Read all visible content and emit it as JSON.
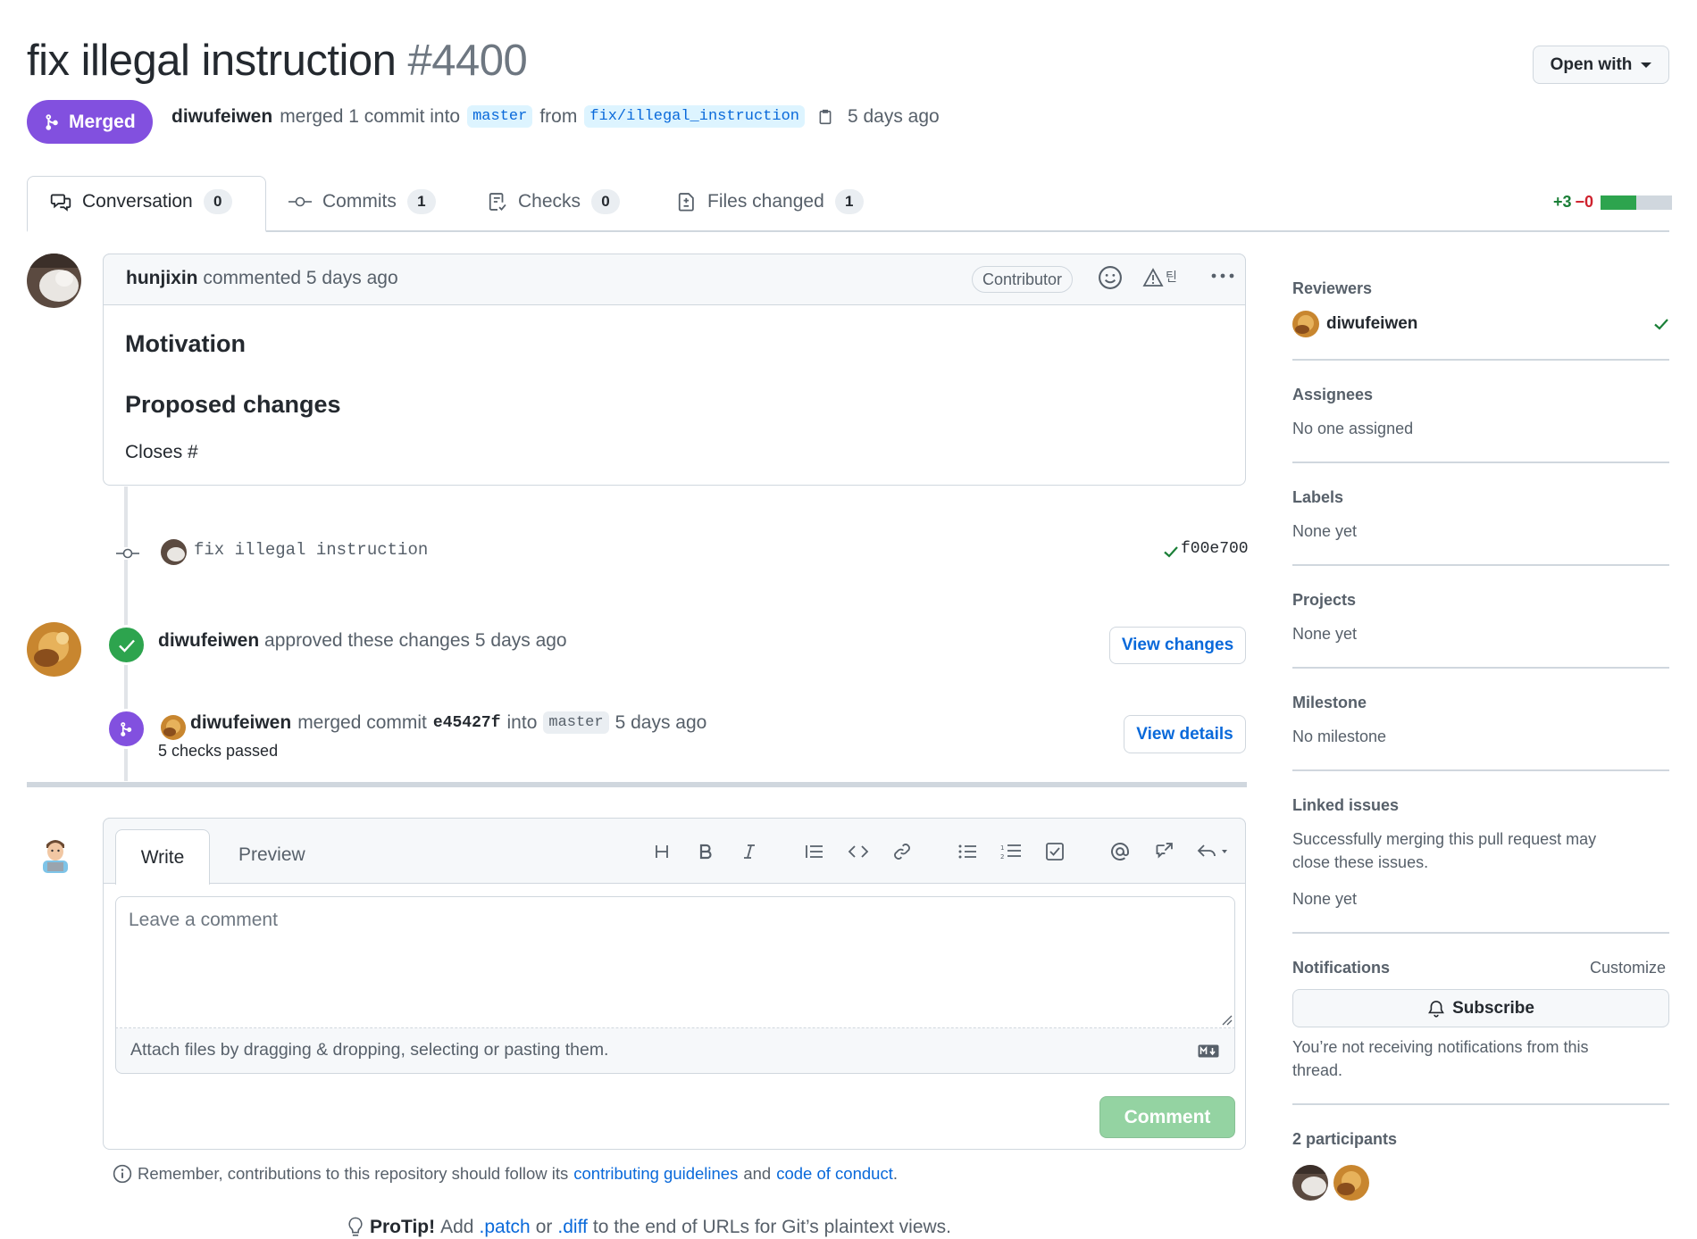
{
  "header": {
    "title": "fix illegal instruction",
    "number": "#4400",
    "open_with_label": "Open with",
    "status": "Merged",
    "author": "diwufeiwen",
    "merge_phrase": "merged 1 commit into",
    "base_branch": "master",
    "from_word": "from",
    "head_branch": "fix/illegal_instruction",
    "time": "5 days ago"
  },
  "tabs": [
    {
      "label": "Conversation",
      "count": "0"
    },
    {
      "label": "Commits",
      "count": "1"
    },
    {
      "label": "Checks",
      "count": "0"
    },
    {
      "label": "Files changed",
      "count": "1"
    }
  ],
  "diffstat": {
    "additions": "+3",
    "deletions": "−0"
  },
  "comment": {
    "author": "hunjixin",
    "action": "commented 5 days ago",
    "role": "Contributor",
    "heading1": "Motivation",
    "heading2": "Proposed changes",
    "body": "Closes #"
  },
  "commit": {
    "message": "fix illegal instruction",
    "sha": "f00e700"
  },
  "review": {
    "author": "diwufeiwen",
    "action": "approved these changes 5 days ago",
    "button": "View changes"
  },
  "merge_event": {
    "author": "diwufeiwen",
    "action": "merged commit",
    "sha": "e45427f",
    "into_word": "into",
    "branch": "master",
    "time": "5 days ago",
    "checks": "5 checks passed",
    "button": "View details"
  },
  "new_comment": {
    "write_tab": "Write",
    "preview_tab": "Preview",
    "placeholder": "Leave a comment",
    "attach_text": "Attach files by dragging & dropping, selecting or pasting them.",
    "submit": "Comment"
  },
  "footer": {
    "remember_prefix": "Remember, contributions to this repository should follow its",
    "contributing_link": "contributing guidelines",
    "and_word": "and",
    "conduct_link": "code of conduct",
    "period": ".",
    "protip_label": "ProTip!",
    "protip_add": "Add",
    "patch_link": ".patch",
    "or_word": "or",
    "diff_link": ".diff",
    "protip_rest": "to the end of URLs for Git’s plaintext views."
  },
  "sidebar": {
    "reviewers_heading": "Reviewers",
    "reviewer_name": "diwufeiwen",
    "assignees_heading": "Assignees",
    "assignees_value": "No one assigned",
    "labels_heading": "Labels",
    "labels_value": "None yet",
    "projects_heading": "Projects",
    "projects_value": "None yet",
    "milestone_heading": "Milestone",
    "milestone_value": "No milestone",
    "linked_heading": "Linked issues",
    "linked_desc_1": "Successfully merging this pull request may",
    "linked_desc_2": "close these issues.",
    "linked_value": "None yet",
    "notifications_heading": "Notifications",
    "customize_label": "Customize",
    "subscribe_label": "Subscribe",
    "notif_desc_1": "You’re not receiving notifications from this",
    "notif_desc_2": "thread.",
    "participants_heading": "2 participants"
  },
  "colors": {
    "merged_purple": "#8250df",
    "success_green": "#1a7f37",
    "link_blue": "#0969da",
    "danger_red": "#cf222e"
  }
}
